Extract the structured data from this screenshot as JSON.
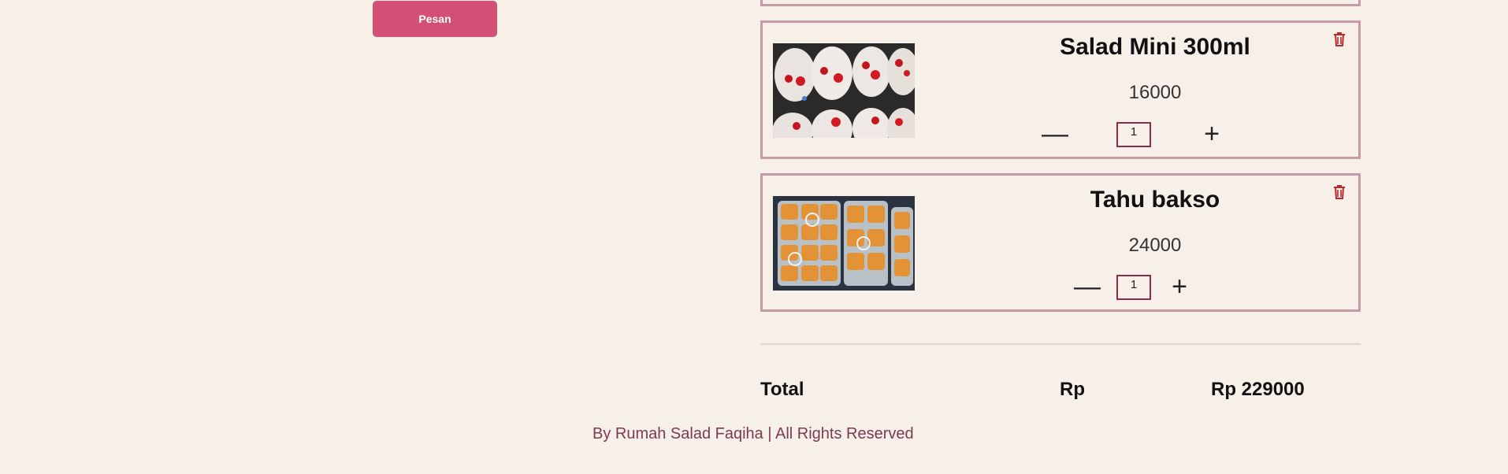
{
  "order_button": {
    "label": "Pesan"
  },
  "cart": {
    "items": [
      {
        "name": "Salad Mini 300ml",
        "price": "16000",
        "quantity": "1",
        "decrement_icon": "minus-icon",
        "increment_icon": "plus-icon",
        "remove_icon": "trash-icon"
      },
      {
        "name": "Tahu bakso",
        "price": "24000",
        "quantity": "1",
        "decrement_icon": "minus-icon",
        "increment_icon": "plus-icon",
        "remove_icon": "trash-icon"
      }
    ]
  },
  "summary": {
    "total_label": "Total",
    "currency_label": "Rp",
    "total_value": "Rp 229000"
  },
  "footer": {
    "text": "By Rumah Salad Faqiha | All Rights Reserved"
  },
  "colors": {
    "background": "#f7f0e9",
    "accent_button": "#d34f75",
    "card_border": "#c69aa6",
    "qty_border": "#8b2b45",
    "trash": "#c0262e",
    "footer_text": "#7b3a52"
  }
}
